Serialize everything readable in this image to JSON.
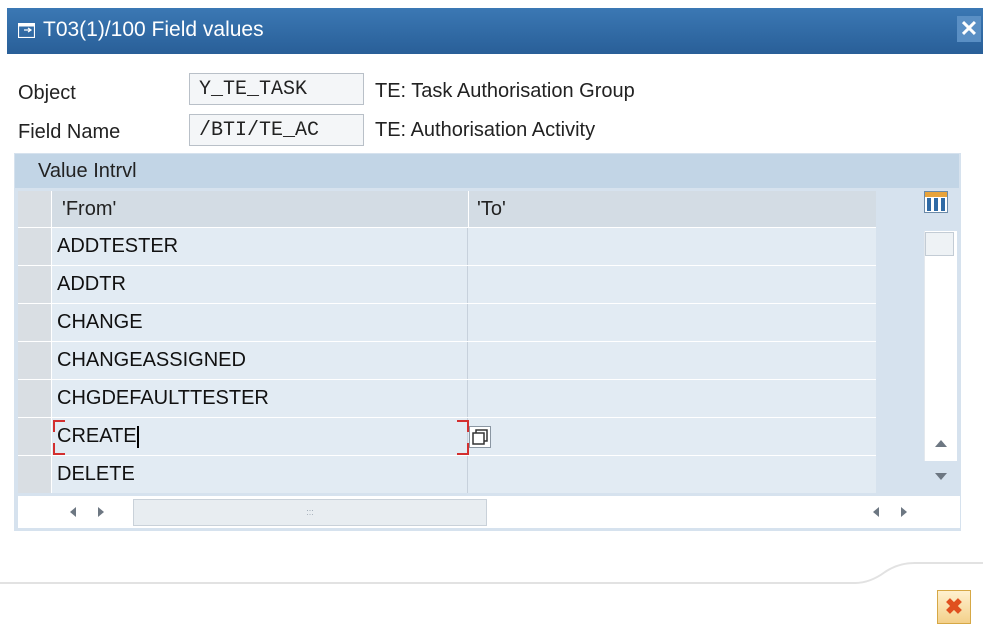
{
  "window": {
    "title": "T03(1)/100 Field values",
    "close_glyph": "✕"
  },
  "object": {
    "label": "Object",
    "value": "Y_TE_TASK",
    "description": "TE: Task Authorisation Group"
  },
  "field_name": {
    "label": "Field Name",
    "value": "/BTI/TE_AC",
    "description": "TE: Authorisation Activity"
  },
  "table": {
    "caption": "Value Intrvl",
    "col_from": "'From'",
    "col_to": "'To'",
    "rows": [
      {
        "from": "ADDTESTER",
        "to": ""
      },
      {
        "from": "ADDTR",
        "to": ""
      },
      {
        "from": "CHANGE",
        "to": ""
      },
      {
        "from": "CHANGEASSIGNED",
        "to": ""
      },
      {
        "from": "CHGDEFAULTTESTER",
        "to": ""
      },
      {
        "from": "CREATE",
        "to": ""
      },
      {
        "from": "DELETE",
        "to": ""
      }
    ],
    "hscroll_grip": ":::"
  },
  "footer": {
    "cancel_glyph": "✖"
  },
  "icons": {
    "title": "dialog-icon",
    "config": "table-settings-icon",
    "value_help": "multiple-selection-icon",
    "cancel": "cancel-icon"
  },
  "colors": {
    "titlebar": "#2f6aa5",
    "table_bg": "#e2ebf3",
    "focus_bracket": "#d32f2f",
    "cancel": "#e0501f"
  }
}
